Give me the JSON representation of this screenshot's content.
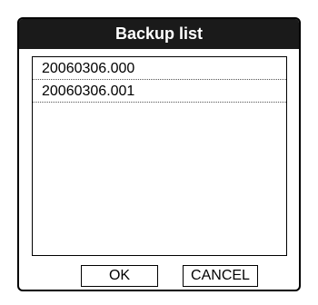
{
  "dialog": {
    "title": "Backup list",
    "items": [
      {
        "label": "20060306.000"
      },
      {
        "label": "20060306.001"
      }
    ],
    "buttons": {
      "ok_label": "OK",
      "cancel_label": "CANCEL"
    }
  },
  "colors": {
    "titlebar_background": "#1a1a1a",
    "titlebar_text": "#ffffff",
    "border": "#000000"
  }
}
